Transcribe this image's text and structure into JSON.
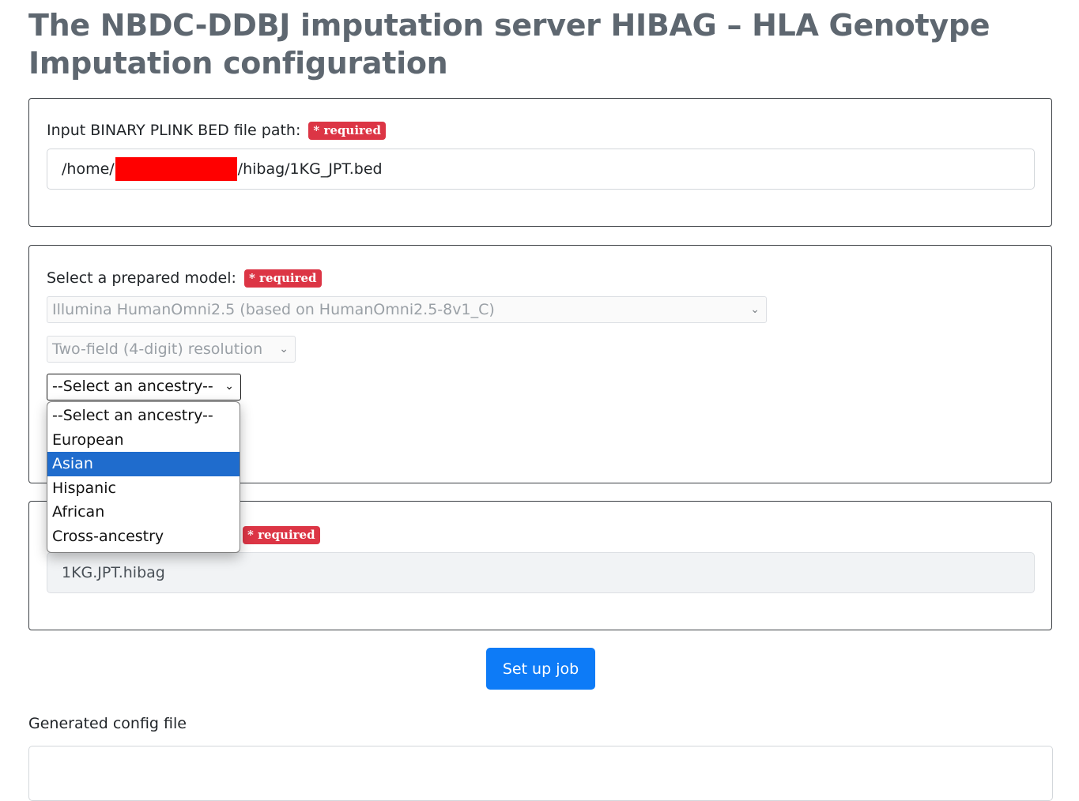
{
  "page": {
    "title": "The NBDC-DDBJ imputation server HIBAG – HLA Genotype Imputation configuration"
  },
  "input_section": {
    "label": "Input BINARY PLINK BED file path:",
    "required_badge": "* required",
    "path_prefix": "/home/",
    "path_suffix": "/hibag/1KG_JPT.bed"
  },
  "model_section": {
    "label": "Select a prepared model:",
    "required_badge": "* required",
    "platform_selected": "Illumina HumanOmni2.5 (based on HumanOmni2.5-8v1_C)",
    "resolution_selected": "Two-field (4-digit) resolution",
    "ancestry_selected": "--Select an ancestry--",
    "ancestry_options": [
      "--Select an ancestry--",
      "European",
      "Asian",
      "Hispanic",
      "African",
      "Cross-ancestry"
    ],
    "highlighted_option": "Asian"
  },
  "output_section": {
    "required_badge": "* required",
    "value": "1KG.JPT.hibag"
  },
  "actions": {
    "setup_label": "Set up job"
  },
  "config": {
    "label": "Generated config file"
  },
  "icons": {
    "dropdown": "chevron-down-icon"
  },
  "colors": {
    "badge": "#dc3545",
    "primary_button": "#0d7bf7",
    "highlight": "#1f6ccd",
    "redaction": "#ff0000"
  }
}
